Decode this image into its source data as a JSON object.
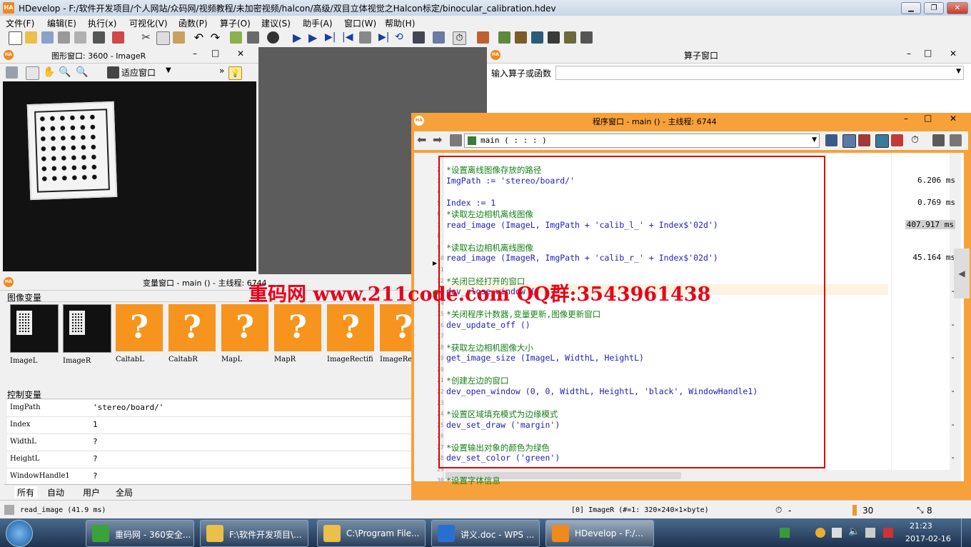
{
  "app": {
    "title": "HDevelop - F:/软件开发项目/个人网站/众码网/视频教程/未加密视频/halcon/高级/双目立体视觉之Halcon标定/binocular_calibration.hdev",
    "logo": "HA"
  },
  "menu": [
    "文件(F)",
    "编辑(E)",
    "执行(x)",
    "可视化(V)",
    "函数(P)",
    "算子(O)",
    "建议(S)",
    "助手(A)",
    "窗口(W)",
    "帮助(H)"
  ],
  "graphics_window": {
    "title": "图形窗口: 3600 - ImageR",
    "zoom_label": "适应窗口"
  },
  "operator_window": {
    "title": "算子窗口",
    "input_label": "输入算子或函数"
  },
  "variable_window": {
    "title": "变量窗口 - main () - 主线程: 6744",
    "image_section": "图像变量",
    "images": [
      {
        "name": "ImageL",
        "kind": "board"
      },
      {
        "name": "ImageR",
        "kind": "board"
      },
      {
        "name": "CaltabL",
        "kind": "?"
      },
      {
        "name": "CaltabR",
        "kind": "?"
      },
      {
        "name": "MapL",
        "kind": "?"
      },
      {
        "name": "MapR",
        "kind": "?"
      },
      {
        "name": "ImageRectifi",
        "kind": "?"
      },
      {
        "name": "ImageRe",
        "kind": "?"
      }
    ],
    "control_section": "控制变量",
    "controls": [
      {
        "name": "ImgPath",
        "value": "'stereo/board/'"
      },
      {
        "name": "Index",
        "value": "1"
      },
      {
        "name": "WidthL",
        "value": "?"
      },
      {
        "name": "HeightL",
        "value": "?"
      },
      {
        "name": "WindowHandle1",
        "value": "?"
      }
    ],
    "tabs": [
      "所有",
      "自动",
      "用户",
      "全局"
    ]
  },
  "program_window": {
    "title": "程序窗口 - main () - 主线程: 6744",
    "procedure": "main ( : : : )",
    "lines": [
      {
        "n": "2",
        "kind": "comment",
        "text": "*设置离线图像存放的路径"
      },
      {
        "n": "3",
        "kind": "stmt",
        "text": "ImgPath := 'stereo/board/'",
        "time": "6.206 ms"
      },
      {
        "n": "4",
        "kind": "blank",
        "text": ""
      },
      {
        "n": "5",
        "kind": "stmt",
        "text": "Index := 1",
        "time": "0.769 ms"
      },
      {
        "n": "6",
        "kind": "comment",
        "text": "*读取左边相机离线图像"
      },
      {
        "n": "7",
        "kind": "stmt",
        "text": "read_image (ImageL, ImgPath + 'calib_l_' + Index$'02d')",
        "time": "407.917 ms"
      },
      {
        "n": "8",
        "kind": "blank",
        "text": ""
      },
      {
        "n": "9",
        "kind": "comment",
        "text": "*读取右边相机离线图像"
      },
      {
        "n": "10",
        "kind": "stmt",
        "text": "read_image (ImageR, ImgPath + 'calib_r_' + Index$'02d')",
        "time": "45.164 ms"
      },
      {
        "n": "11",
        "kind": "blank",
        "text": ""
      },
      {
        "n": "12",
        "kind": "comment",
        "text": "*关闭已经打开的窗口"
      },
      {
        "n": "13",
        "kind": "stmt",
        "text": "dev_close_window ()",
        "time": "-"
      },
      {
        "n": "14",
        "kind": "blank",
        "text": ""
      },
      {
        "n": "15",
        "kind": "comment",
        "text": "*关闭程序计数器,变量更新,图像更新窗口"
      },
      {
        "n": "16",
        "kind": "stmt",
        "text": "dev_update_off ()",
        "time": "-"
      },
      {
        "n": "17",
        "kind": "blank",
        "text": ""
      },
      {
        "n": "18",
        "kind": "comment",
        "text": "*获取左边相机图像大小"
      },
      {
        "n": "19",
        "kind": "stmt",
        "text": "get_image_size (ImageL, WidthL, HeightL)",
        "time": "-"
      },
      {
        "n": "20",
        "kind": "blank",
        "text": ""
      },
      {
        "n": "21",
        "kind": "comment",
        "text": "*创建左边的窗口"
      },
      {
        "n": "22",
        "kind": "stmt",
        "text": "dev_open_window (0, 0, WidthL, HeightL, 'black', WindowHandle1)",
        "time": "-"
      },
      {
        "n": "23",
        "kind": "blank",
        "text": ""
      },
      {
        "n": "24",
        "kind": "comment",
        "text": "*设置区域填充模式为边缘模式"
      },
      {
        "n": "25",
        "kind": "stmt",
        "text": "dev_set_draw ('margin')",
        "time": "-"
      },
      {
        "n": "26",
        "kind": "blank",
        "text": ""
      },
      {
        "n": "27",
        "kind": "comment",
        "text": "*设置输出对象的颜色为绿色"
      },
      {
        "n": "28",
        "kind": "stmt",
        "text": "dev_set_color ('green')",
        "time": "-"
      },
      {
        "n": "29",
        "kind": "blank",
        "text": ""
      },
      {
        "n": "30",
        "kind": "comment",
        "text": "*设置字体信息"
      }
    ]
  },
  "watermark": "重码网 www.211code.com QQ群:3543961438",
  "statusbar": {
    "message": "read_image (41.9 ms)",
    "image_info": "[0] ImageR (#=1: 320×240×1×byte)",
    "timer": "-",
    "count": "30",
    "zoom": "8"
  },
  "taskbar": {
    "items": [
      {
        "label": "重码网 - 360安全...",
        "color": "#3aa23a"
      },
      {
        "label": "F:\\软件开发项目\\...",
        "color": "#e8c04a"
      },
      {
        "label": "C:\\Program File...",
        "color": "#e8c04a"
      },
      {
        "label": "讲义.doc - WPS ...",
        "color": "#2a6fd0"
      },
      {
        "label": "HDevelop - F:/...",
        "color": "#f08a1c"
      }
    ],
    "time": "21:23",
    "date": "2017-02-16"
  },
  "colors": {
    "accent": "#f7a13a",
    "comment": "#178017",
    "statement": "#2020c0",
    "highlight_box": "#e00000",
    "watermark": "#e8001a"
  }
}
